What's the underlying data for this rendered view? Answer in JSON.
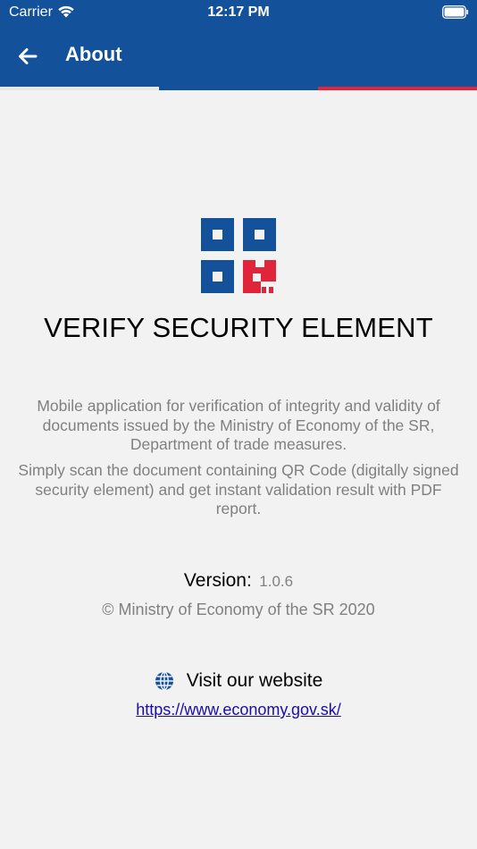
{
  "status_bar": {
    "carrier": "Carrier",
    "time": "12:17 PM"
  },
  "app_bar": {
    "title": "About",
    "background_color": "#13519b",
    "stripe_colors": [
      "#e8e8e8",
      "#13519b",
      "#e0243a"
    ]
  },
  "logo": {
    "icon": "qr-security-logo-icon",
    "colors": {
      "blue": "#13519b",
      "red": "#e0243a"
    }
  },
  "content": {
    "app_name": "VERIFY SECURITY ELEMENT",
    "description_1": "Mobile application for verification of integrity and validity of documents issued by the Ministry of Economy of the SR, Department of trade measures.",
    "description_2": "Simply scan the document containing QR Code (digitally signed security element) and get instant validation result with PDF report.",
    "version_label": "Version:",
    "version_value": "1.0.6",
    "copyright": "© Ministry of Economy of the SR 2020",
    "visit_label": "Visit our website",
    "website_url": "https://www.economy.gov.sk/"
  }
}
